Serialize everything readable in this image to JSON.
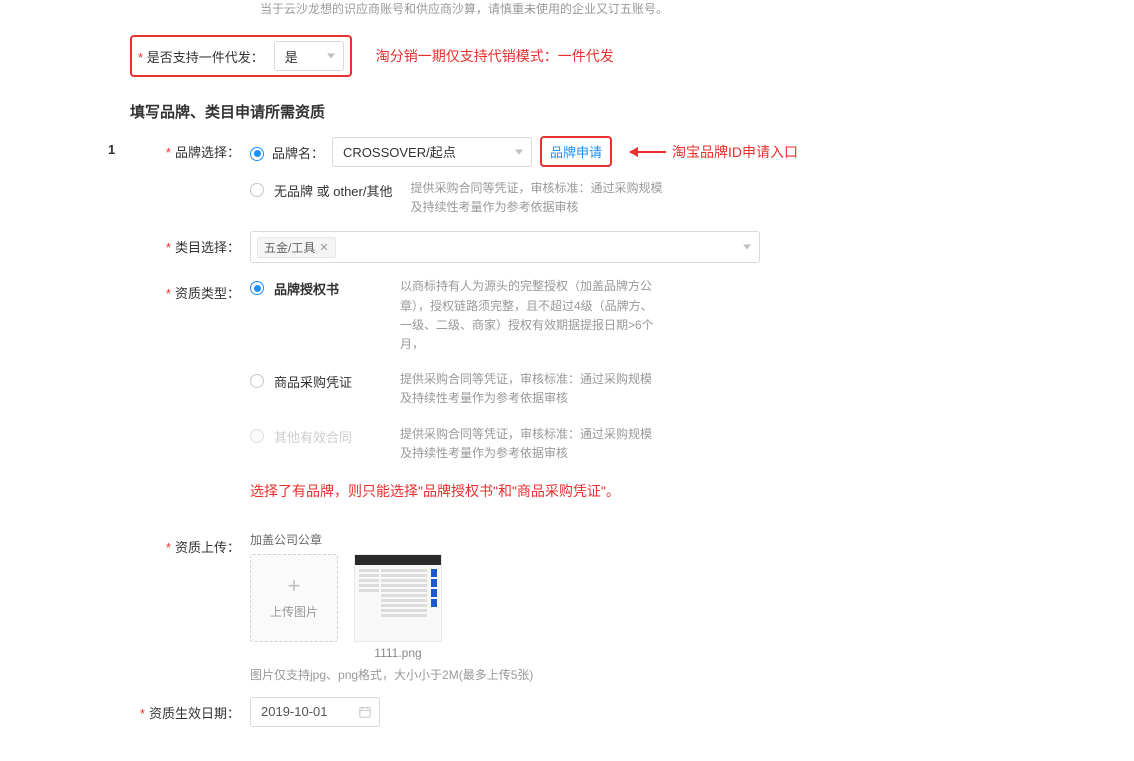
{
  "top_note": "当于云沙龙想的识应商账号和供应商沙算，请慎重未使用的企业又订五账号。",
  "dropship": {
    "label": "是否支持一件代发：",
    "value": "是",
    "annotation": "淘分销一期仅支持代销模式：一件代发"
  },
  "section_title": "填写品牌、类目申请所需资质",
  "brand": {
    "index": "1",
    "label": "品牌选择：",
    "radio_brand_name": "品牌名：",
    "brand_value": "CROSSOVER/起点",
    "apply_link": "品牌申请",
    "annotation": "淘宝品牌ID申请入口",
    "radio_no_brand": "无品牌 或 other/其他",
    "no_brand_hint": "提供采购合同等凭证，审核标准：通过采购规模及持续性考量作为参考依据审核"
  },
  "category": {
    "label": "类目选择：",
    "tag": "五金/工具"
  },
  "qual_type": {
    "label": "资质类型：",
    "opt1": {
      "label": "品牌授权书",
      "hint": "以商标持有人为源头的完整授权（加盖品牌方公章），授权链路须完整，且不超过4级（品牌方、一级、二级、商家）授权有效期据提报日期>6个月，"
    },
    "opt2": {
      "label": "商品采购凭证",
      "hint": "提供采购合同等凭证，审核标准：通过采购规模及持续性考量作为参考依据审核"
    },
    "opt3": {
      "label": "其他有效合同",
      "hint": "提供采购合同等凭证，审核标准：通过采购规模及持续性考量作为参考依据审核"
    },
    "annotation": "选择了有品牌，则只能选择\"品牌授权书\"和\"商品采购凭证\"。"
  },
  "upload": {
    "label": "资质上传：",
    "caption": "加盖公司公章",
    "btn": "上传图片",
    "thumb_name": "1111.png",
    "hint": "图片仅支持jpg、png格式，大小小于2M(最多上传5张)"
  },
  "effective": {
    "label": "资质生效日期：",
    "value": "2019-10-01"
  }
}
